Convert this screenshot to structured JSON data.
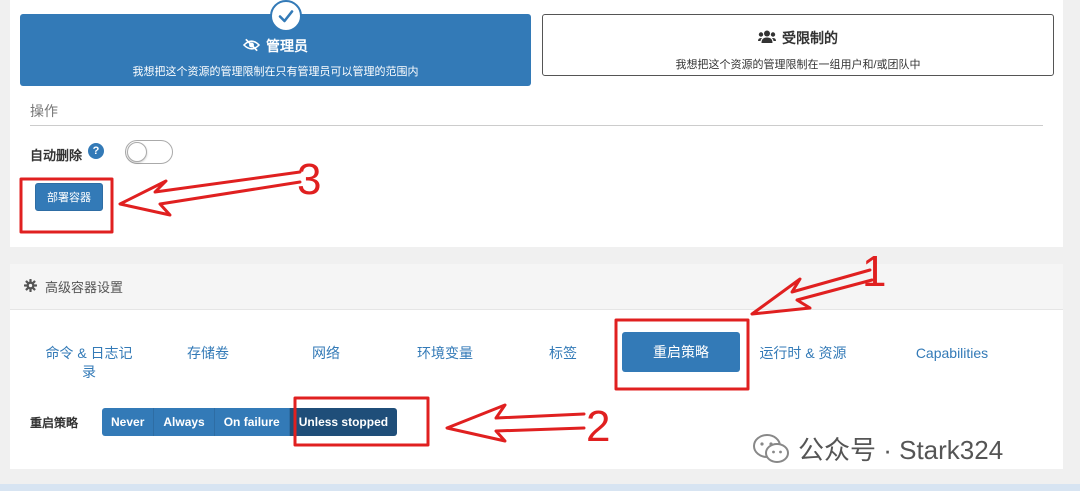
{
  "access": {
    "admin": {
      "title": "管理员",
      "description": "我想把这个资源的管理限制在只有管理员可以管理的范围内",
      "icon": "eye-slash-icon"
    },
    "restricted": {
      "title": "受限制的",
      "description": "我想把这个资源的管理限制在一组用户和/或团队中",
      "icon": "users-icon"
    }
  },
  "actions": {
    "section_title": "操作",
    "auto_remove_label": "自动删除",
    "help": "?",
    "auto_remove_enabled": false,
    "deploy_label": "部署容器"
  },
  "advanced": {
    "title": "高级容器设置",
    "tabs": [
      {
        "label": "命令 & 日志记录"
      },
      {
        "label": "存储卷"
      },
      {
        "label": "网络"
      },
      {
        "label": "环境变量"
      },
      {
        "label": "标签"
      },
      {
        "label": "重启策略",
        "active": true
      },
      {
        "label": "运行时 & 资源"
      },
      {
        "label": "Capabilities"
      }
    ],
    "restart_label": "重启策略",
    "restart_options": [
      "Never",
      "Always",
      "On failure",
      "Unless stopped"
    ],
    "restart_selected": "Unless stopped"
  },
  "annotations": {
    "step1": "1",
    "step2": "2",
    "step3": "3"
  },
  "watermark": {
    "text": "公众号 · Stark324"
  },
  "colors": {
    "primary": "#337ab7",
    "selected": "#1f4e79",
    "annotation": "#e02020"
  }
}
